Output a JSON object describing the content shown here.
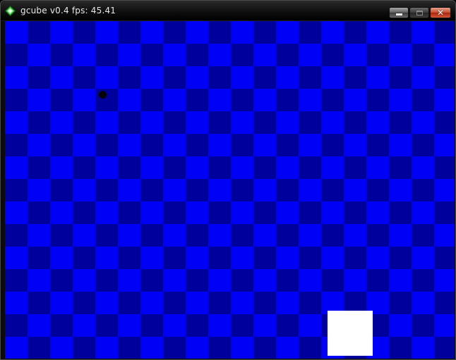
{
  "window": {
    "title": "gcube v0.4 fps: 45.41",
    "app_icon": "gcube-gem-icon",
    "buttons": {
      "minimize_icon": "minimize-icon",
      "maximize_icon": "maximize-icon",
      "close_icon": "close-icon",
      "close_glyph": "✕"
    }
  },
  "scene": {
    "floor_colors": {
      "light": "#0000f6",
      "dark": "#00009c"
    },
    "ball_color": "#050505",
    "cube_color": "#ffffff"
  }
}
